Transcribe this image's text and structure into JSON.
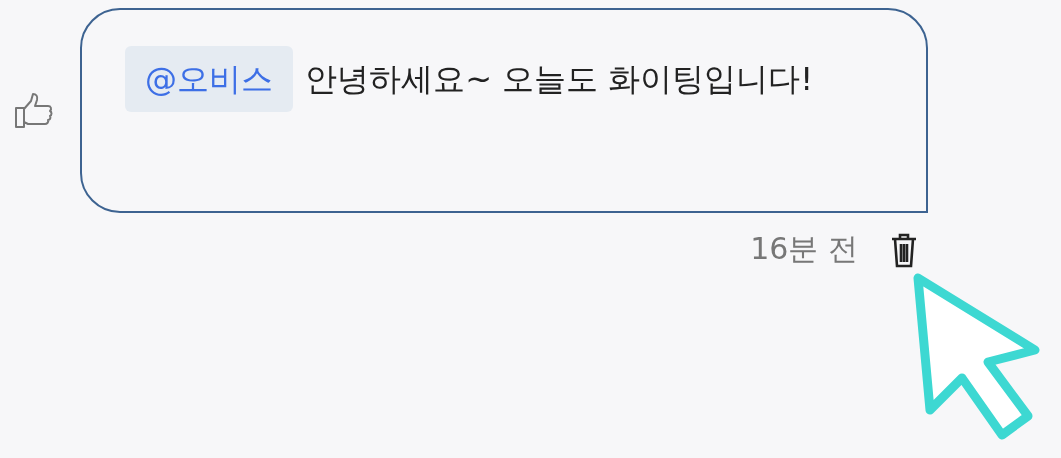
{
  "message": {
    "mention": "@오비스",
    "text": "안녕하세요~ 오늘도 화이팅입니다!"
  },
  "time": "16분 전"
}
